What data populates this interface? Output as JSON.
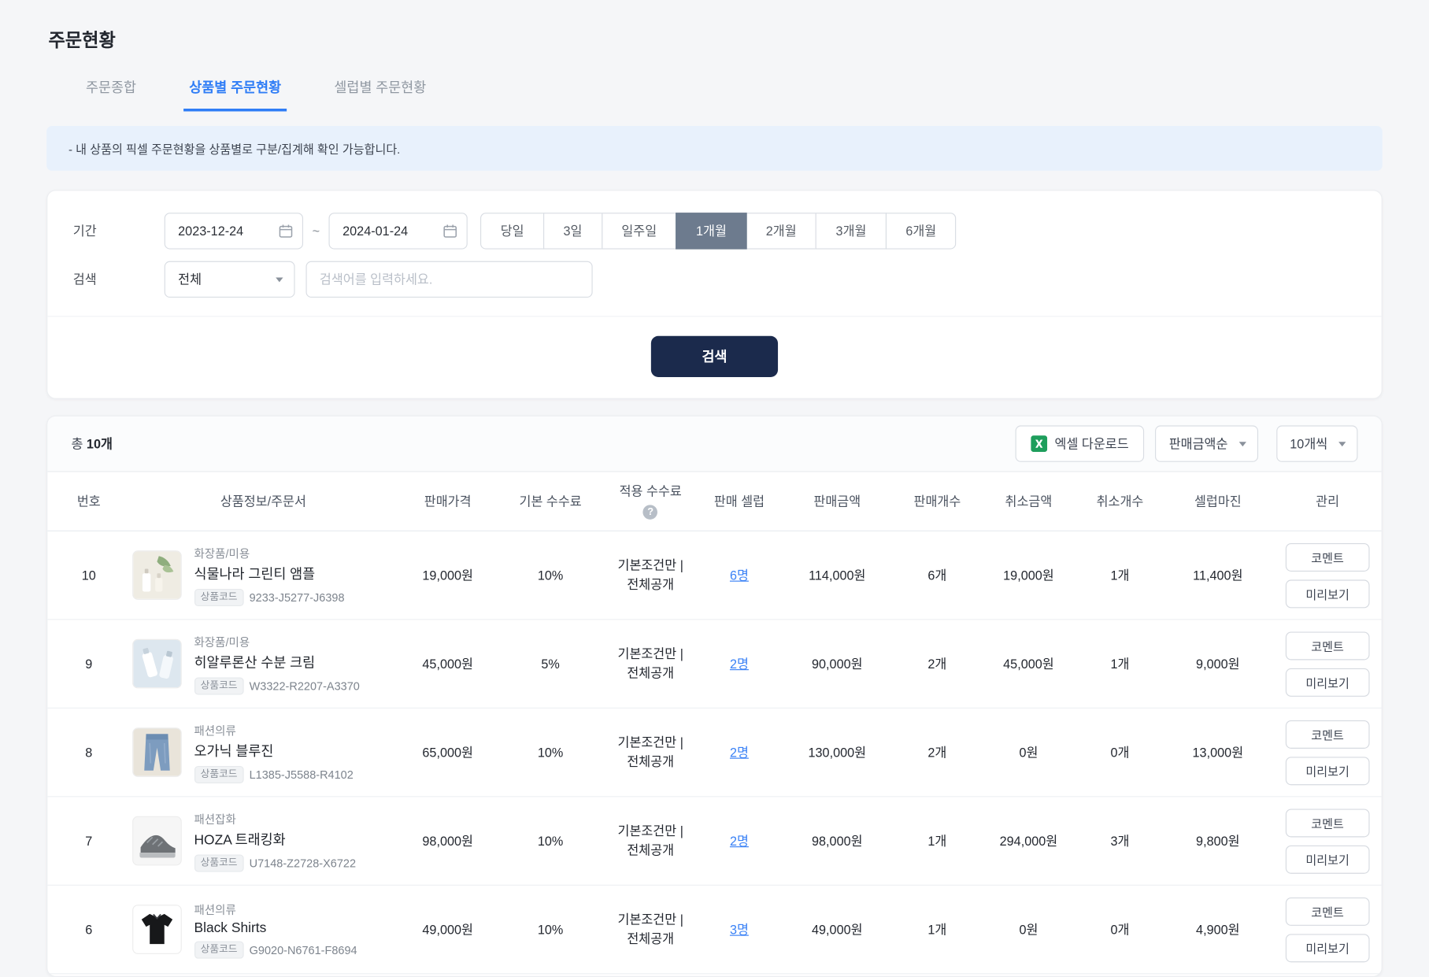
{
  "page": {
    "title": "주문현황"
  },
  "tabs": [
    {
      "label": "주문종합"
    },
    {
      "label": "상품별 주문현황"
    },
    {
      "label": "셀럽별 주문현황"
    }
  ],
  "notice": "-  내 상품의 픽셀 주문현황을 상품별로 구분/집계해 확인 가능합니다.",
  "filter": {
    "period_label": "기간",
    "date_from": "2023-12-24",
    "date_to": "2024-01-24",
    "range_separator": "~",
    "quick_ranges": [
      "당일",
      "3일",
      "일주일",
      "1개월",
      "2개월",
      "3개월",
      "6개월"
    ],
    "active_range": "1개월",
    "search_label": "검색",
    "category_value": "전체",
    "keyword_placeholder": "검색어를 입력하세요.",
    "submit_label": "검색"
  },
  "toolbar": {
    "total_prefix": "총",
    "total_value": "10개",
    "excel_label": "엑셀 다운로드",
    "sort_value": "판매금액순",
    "page_size_value": "10개씩"
  },
  "table": {
    "headers": {
      "no": "번호",
      "product": "상품정보/주문서",
      "price": "판매가격",
      "base_fee": "기본 수수료",
      "applied_fee": "적용 수수료",
      "sellers": "판매 셀럽",
      "sales_amount": "판매금액",
      "sales_count": "판매개수",
      "cancel_amount": "취소금액",
      "cancel_count": "취소개수",
      "celeb_margin": "셀럽마진",
      "manage": "관리"
    },
    "question_glyph": "?",
    "code_label": "상품코드",
    "comment_label": "코멘트",
    "preview_label": "미리보기",
    "rows": [
      {
        "no": "10",
        "category": "화장품/미용",
        "name": "식물나라 그린티 앰플",
        "code": "9233-J5277-J6398",
        "price": "19,000원",
        "base_fee": "10%",
        "applied_fee": "기본조건만 | 전체공개",
        "sellers": "6명",
        "sales_amount": "114,000원",
        "sales_count": "6개",
        "cancel_amount": "19,000원",
        "cancel_count": "1개",
        "celeb_margin": "11,400원"
      },
      {
        "no": "9",
        "category": "화장품/미용",
        "name": "히알루론산 수분 크림",
        "code": "W3322-R2207-A3370",
        "price": "45,000원",
        "base_fee": "5%",
        "applied_fee": "기본조건만 | 전체공개",
        "sellers": "2명",
        "sales_amount": "90,000원",
        "sales_count": "2개",
        "cancel_amount": "45,000원",
        "cancel_count": "1개",
        "celeb_margin": "9,000원"
      },
      {
        "no": "8",
        "category": "패션의류",
        "name": "오가닉 블루진",
        "code": "L1385-J5588-R4102",
        "price": "65,000원",
        "base_fee": "10%",
        "applied_fee": "기본조건만 | 전체공개",
        "sellers": "2명",
        "sales_amount": "130,000원",
        "sales_count": "2개",
        "cancel_amount": "0원",
        "cancel_count": "0개",
        "celeb_margin": "13,000원"
      },
      {
        "no": "7",
        "category": "패션잡화",
        "name": "HOZA 트래킹화",
        "code": "U7148-Z2728-X6722",
        "price": "98,000원",
        "base_fee": "10%",
        "applied_fee": "기본조건만 | 전체공개",
        "sellers": "2명",
        "sales_amount": "98,000원",
        "sales_count": "1개",
        "cancel_amount": "294,000원",
        "cancel_count": "3개",
        "celeb_margin": "9,800원"
      },
      {
        "no": "6",
        "category": "패션의류",
        "name": "Black Shirts",
        "code": "G9020-N6761-F8694",
        "price": "49,000원",
        "base_fee": "10%",
        "applied_fee": "기본조건만 | 전체공개",
        "sellers": "3명",
        "sales_amount": "49,000원",
        "sales_count": "1개",
        "cancel_amount": "0원",
        "cancel_count": "0개",
        "celeb_margin": "4,900원"
      }
    ]
  },
  "colors": {
    "accent_blue": "#2f7df6",
    "dark_navy": "#1b2a4c",
    "active_segment": "#6d7b8e",
    "excel_green": "#1e9e5c",
    "banner_bg": "#e8f1fc"
  }
}
